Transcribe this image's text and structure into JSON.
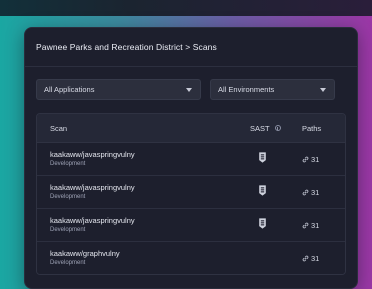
{
  "header": {
    "breadcrumb": "Pawnee Parks and Recreation District > Scans"
  },
  "filters": {
    "applications": "All Applications",
    "environments": "All Environments"
  },
  "table": {
    "columns": {
      "scan": "Scan",
      "sast": "SAST",
      "paths": "Paths"
    },
    "rows": [
      {
        "name": "kaakaww/javaspringvulny",
        "env": "Development",
        "sast_icon": "tag-icon",
        "paths": "31"
      },
      {
        "name": "kaakaww/javaspringvulny",
        "env": "Development",
        "sast_icon": "tag-icon",
        "paths": "31"
      },
      {
        "name": "kaakaww/javaspringvulny",
        "env": "Development",
        "sast_icon": "tag-icon",
        "paths": "31"
      },
      {
        "name": "kaakaww/graphvulny",
        "env": "Development",
        "sast_icon": "",
        "paths": "31"
      }
    ]
  },
  "colors": {
    "panel": "#1d1f2d",
    "gradient_start": "#1aa7a2",
    "gradient_end": "#9b37a6"
  }
}
